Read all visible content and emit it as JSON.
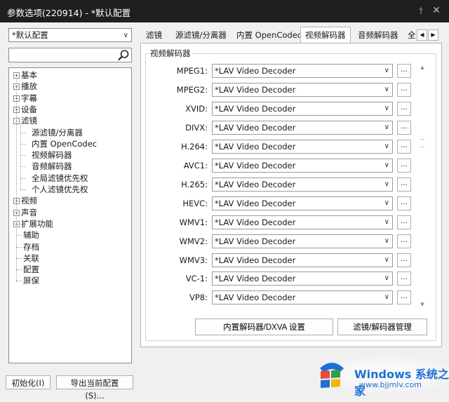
{
  "window": {
    "title": "参数选项(220914) - *默认配置"
  },
  "left": {
    "profile": "*默认配置",
    "tree": [
      {
        "label": "基本",
        "toggle": "+",
        "level": 0
      },
      {
        "label": "播放",
        "toggle": "+",
        "level": 0
      },
      {
        "label": "字幕",
        "toggle": "+",
        "level": 0
      },
      {
        "label": "设备",
        "toggle": "+",
        "level": 0
      },
      {
        "label": "滤镜",
        "toggle": "-",
        "level": 0
      },
      {
        "label": "源滤镜/分离器",
        "level": 1
      },
      {
        "label": "内置 OpenCodec",
        "level": 1
      },
      {
        "label": "视频解码器",
        "level": 1
      },
      {
        "label": "音频解码器",
        "level": 1
      },
      {
        "label": "全局滤镜优先权",
        "level": 1
      },
      {
        "label": "个人滤镜优先权",
        "level": 1
      },
      {
        "label": "视频",
        "toggle": "+",
        "level": 0
      },
      {
        "label": "声音",
        "toggle": "+",
        "level": 0
      },
      {
        "label": "扩展功能",
        "toggle": "+",
        "level": 0
      },
      {
        "label": "辅助",
        "level": 0
      },
      {
        "label": "存档",
        "level": 0
      },
      {
        "label": "关联",
        "level": 0
      },
      {
        "label": "配置",
        "level": 0
      },
      {
        "label": "屏保",
        "level": 0
      }
    ]
  },
  "tabs": [
    "滤镜",
    "源滤镜/分离器",
    "内置 OpenCodec",
    "视频解码器",
    "音频解码器",
    "全"
  ],
  "group": {
    "title": "视频解码器"
  },
  "rows": [
    {
      "label": "MPEG1:",
      "value": "*LAV Video Decoder"
    },
    {
      "label": "MPEG2:",
      "value": "*LAV Video Decoder"
    },
    {
      "label": "XVID:",
      "value": "*LAV Video Decoder"
    },
    {
      "label": "DIVX:",
      "value": "*LAV Video Decoder"
    },
    {
      "label": "H.264:",
      "value": "*LAV Video Decoder"
    },
    {
      "label": "AVC1:",
      "value": "*LAV Video Decoder"
    },
    {
      "label": "H.265:",
      "value": "*LAV Video Decoder"
    },
    {
      "label": "HEVC:",
      "value": "*LAV Video Decoder"
    },
    {
      "label": "WMV1:",
      "value": "*LAV Video Decoder"
    },
    {
      "label": "WMV2:",
      "value": "*LAV Video Decoder"
    },
    {
      "label": "WMV3:",
      "value": "*LAV Video Decoder"
    },
    {
      "label": "VC-1:",
      "value": "*LAV Video Decoder"
    },
    {
      "label": "VP8:",
      "value": "*LAV Video Decoder"
    }
  ],
  "ellipsis": "...",
  "actions": {
    "builtin": "内置解码器/DXVA 设置",
    "manage": "滤镜/解码器管理"
  },
  "bottom": {
    "init": "初始化(I)",
    "export": "导出当前配置(S)..."
  },
  "watermark": {
    "brand": "Windows",
    "brand_cn": "系统之家",
    "url": "www.bjjmlv.com"
  }
}
